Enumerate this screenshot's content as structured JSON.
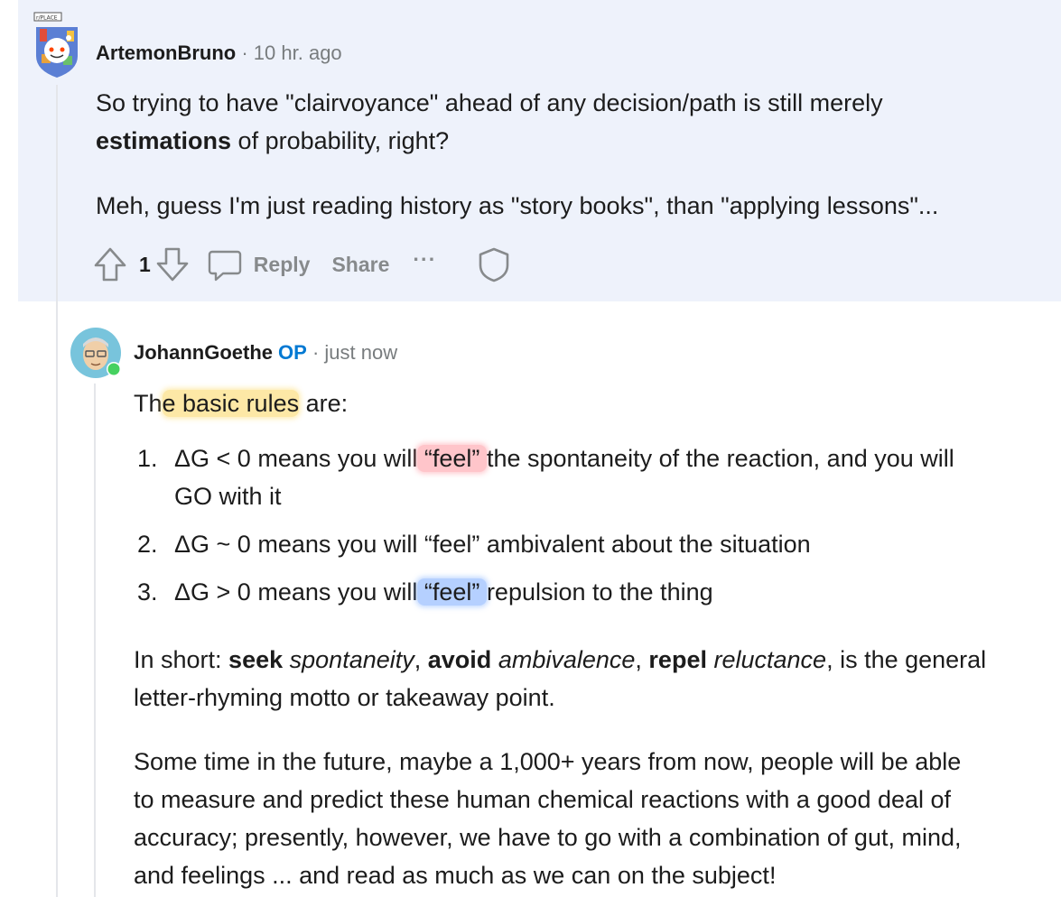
{
  "comment1": {
    "username": "ArtemonBruno",
    "separator": "·",
    "time": "10 hr. ago",
    "avatar_badge": "r/PLACE",
    "para1_a": "So trying to have \"clairvoyance\" ahead of any decision/path is still merely",
    "para1_bold": "estimations",
    "para1_b": " of probability, right?",
    "para2": "Meh, guess I'm just reading history as \"story books\", than \"applying lessons\"...",
    "vote_count": "1",
    "reply_label": "Reply",
    "share_label": "Share",
    "more_label": "···",
    "icons": [
      "upvote-icon",
      "downvote-icon",
      "comment-icon",
      "more-icon",
      "shield-icon"
    ]
  },
  "comment2": {
    "username": "JohannGoethe",
    "op_label": "OP",
    "separator": "·",
    "time": "just now",
    "intro_a": "Th",
    "intro_hl": "e basic rules",
    "intro_b": " are:",
    "rules": [
      {
        "num": "1.",
        "a": "ΔG < 0 means you will",
        "hl": " “feel” ",
        "b": "the spontaneity of the reaction, and you will",
        "line2": "GO with it"
      },
      {
        "num": "2.",
        "a": "ΔG ~ 0 means you will “feel” ambivalent about the situation"
      },
      {
        "num": "3.",
        "a": "ΔG > 0 means you will",
        "hl": " “feel” ",
        "b": "repulsion to the thing"
      }
    ],
    "short": {
      "lead": "In short: ",
      "w1": "seek",
      "i1": "spontaneity",
      "c1": ", ",
      "w2": "avoid",
      "i2": "ambivalence",
      "c2": ", ",
      "w3": "repel",
      "i3": "reluctance",
      "tail": ", is the general",
      "line2": "letter-rhyming motto or takeaway point."
    },
    "future_lines": [
      "Some time in the future, maybe a 1,000+ years from now, people will be able",
      "to measure and predict these human chemical reactions with a good deal of",
      "accuracy; presently, however, we have to go with a combination of gut, mind,",
      "and feelings ... and read as much as we can on the subject!"
    ]
  },
  "colors": {
    "comment1_bg": "#eef2fb",
    "op_blue": "#0079d3",
    "action_gray": "#878a8c",
    "online_green": "#46d160"
  }
}
